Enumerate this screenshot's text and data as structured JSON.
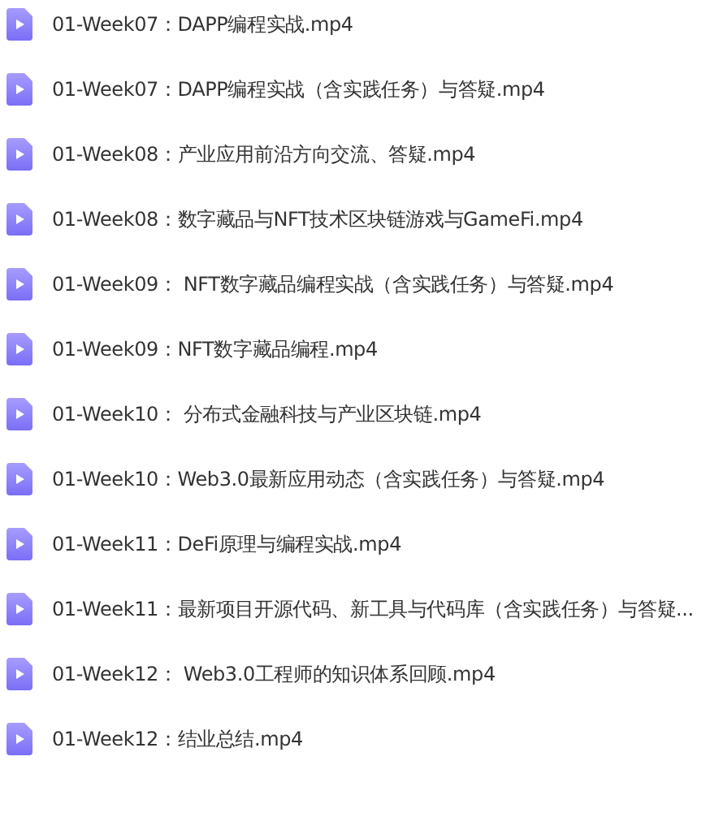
{
  "files": [
    {
      "name": "01-Week07：DAPP编程实战.mp4"
    },
    {
      "name": "01-Week07：DAPP编程实战（含实践任务）与答疑.mp4"
    },
    {
      "name": "01-Week08：产业应用前沿方向交流、答疑.mp4"
    },
    {
      "name": "01-Week08：数字藏品与NFT技术区块链游戏与GameFi.mp4"
    },
    {
      "name": "01-Week09： NFT数字藏品编程实战（含实践任务）与答疑.mp4"
    },
    {
      "name": "01-Week09：NFT数字藏品编程.mp4"
    },
    {
      "name": "01-Week10： 分布式金融科技与产业区块链.mp4"
    },
    {
      "name": "01-Week10：Web3.0最新应用动态（含实践任务）与答疑.mp4"
    },
    {
      "name": "01-Week11：DeFi原理与编程实战.mp4"
    },
    {
      "name": "01-Week11：最新项目开源代码、新工具与代码库（含实践任务）与答疑..."
    },
    {
      "name": "01-Week12： Web3.0工程师的知识体系回顾.mp4"
    },
    {
      "name": "01-Week12：结业总结.mp4"
    }
  ]
}
